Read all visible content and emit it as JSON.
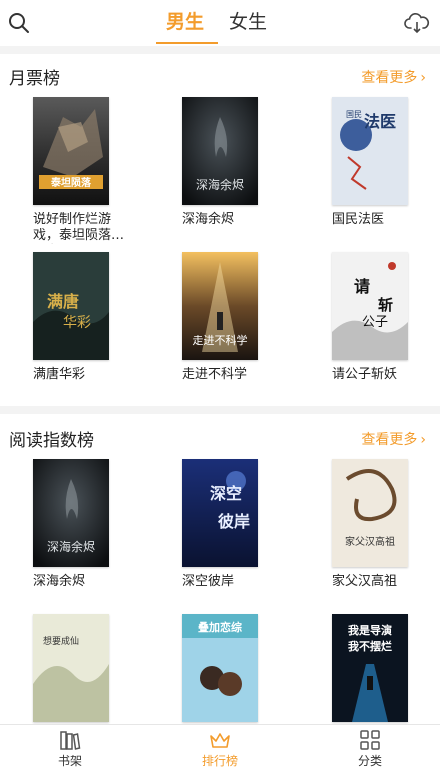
{
  "header": {
    "tabs": [
      {
        "label": "男生",
        "active": true
      },
      {
        "label": "女生",
        "active": false
      }
    ],
    "search_icon": "search-icon",
    "download_icon": "cloud-download-icon",
    "accent": "#f39c2c"
  },
  "sections": [
    {
      "title": "月票榜",
      "more_label": "查看更多",
      "books": [
        {
          "title": "说好制作烂游戏，泰坦陨落什么鬼",
          "cover_text": "说好制作烂游戏泰坦陨落什么鬼"
        },
        {
          "title": "深海余烬",
          "cover_text": "深海余烬"
        },
        {
          "title": "国民法医",
          "cover_text": "国民法医"
        },
        {
          "title": "满唐华彩",
          "cover_text": "满唐华彩"
        },
        {
          "title": "走进不科学",
          "cover_text": "走进不科学"
        },
        {
          "title": "请公子斩妖",
          "cover_text": "请公子斩妖"
        }
      ]
    },
    {
      "title": "阅读指数榜",
      "more_label": "查看更多",
      "books": [
        {
          "title": "深海余烬",
          "cover_text": "深海余烬"
        },
        {
          "title": "深空彼岸",
          "cover_text": "深空彼岸"
        },
        {
          "title": "家父汉高祖",
          "cover_text": "家父汉高祖"
        },
        {
          "title": "",
          "cover_text": "想要成仙"
        },
        {
          "title": "",
          "cover_text": "叠加恋综"
        },
        {
          "title": "",
          "cover_text": "我是导演，我不摆烂"
        }
      ]
    }
  ],
  "bottom_nav": [
    {
      "label": "书架",
      "icon": "bookshelf-icon",
      "active": false
    },
    {
      "label": "排行榜",
      "icon": "crown-icon",
      "active": true
    },
    {
      "label": "分类",
      "icon": "grid-icon",
      "active": false
    }
  ]
}
